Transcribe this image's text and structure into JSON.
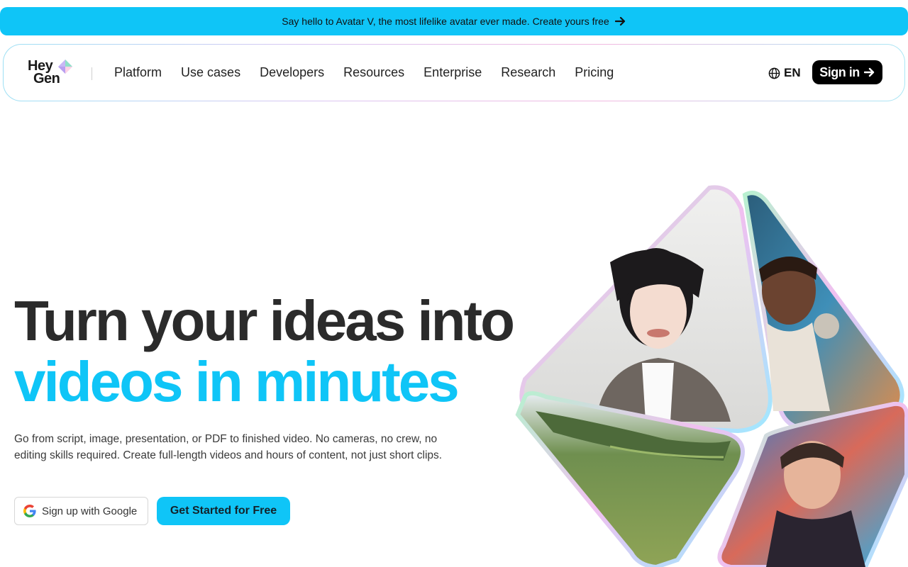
{
  "announcement": {
    "text": "Say hello to Avatar V, the most lifelike avatar ever made. Create yours free",
    "arrow_icon": "arrow-right-icon"
  },
  "nav": {
    "logo_line1": "Hey",
    "logo_line2": "Gen",
    "links": [
      "Platform",
      "Use cases",
      "Developers",
      "Resources",
      "Enterprise",
      "Research",
      "Pricing"
    ],
    "language": "EN",
    "signin_label": "Sign in"
  },
  "hero": {
    "title_line1": "Turn your ideas into",
    "title_line2": "videos in minutes",
    "subtitle": "Go from script, image, presentation, or PDF to finished video. No cameras, no crew, no editing skills required. Create full-length videos and hours of content, not just short clips.",
    "google_button": "Sign up with Google",
    "start_button": "Get Started for Free"
  },
  "colors": {
    "accent": "#0fc5f7",
    "title_dark": "#2b2b2b",
    "button_dark": "#000000"
  }
}
